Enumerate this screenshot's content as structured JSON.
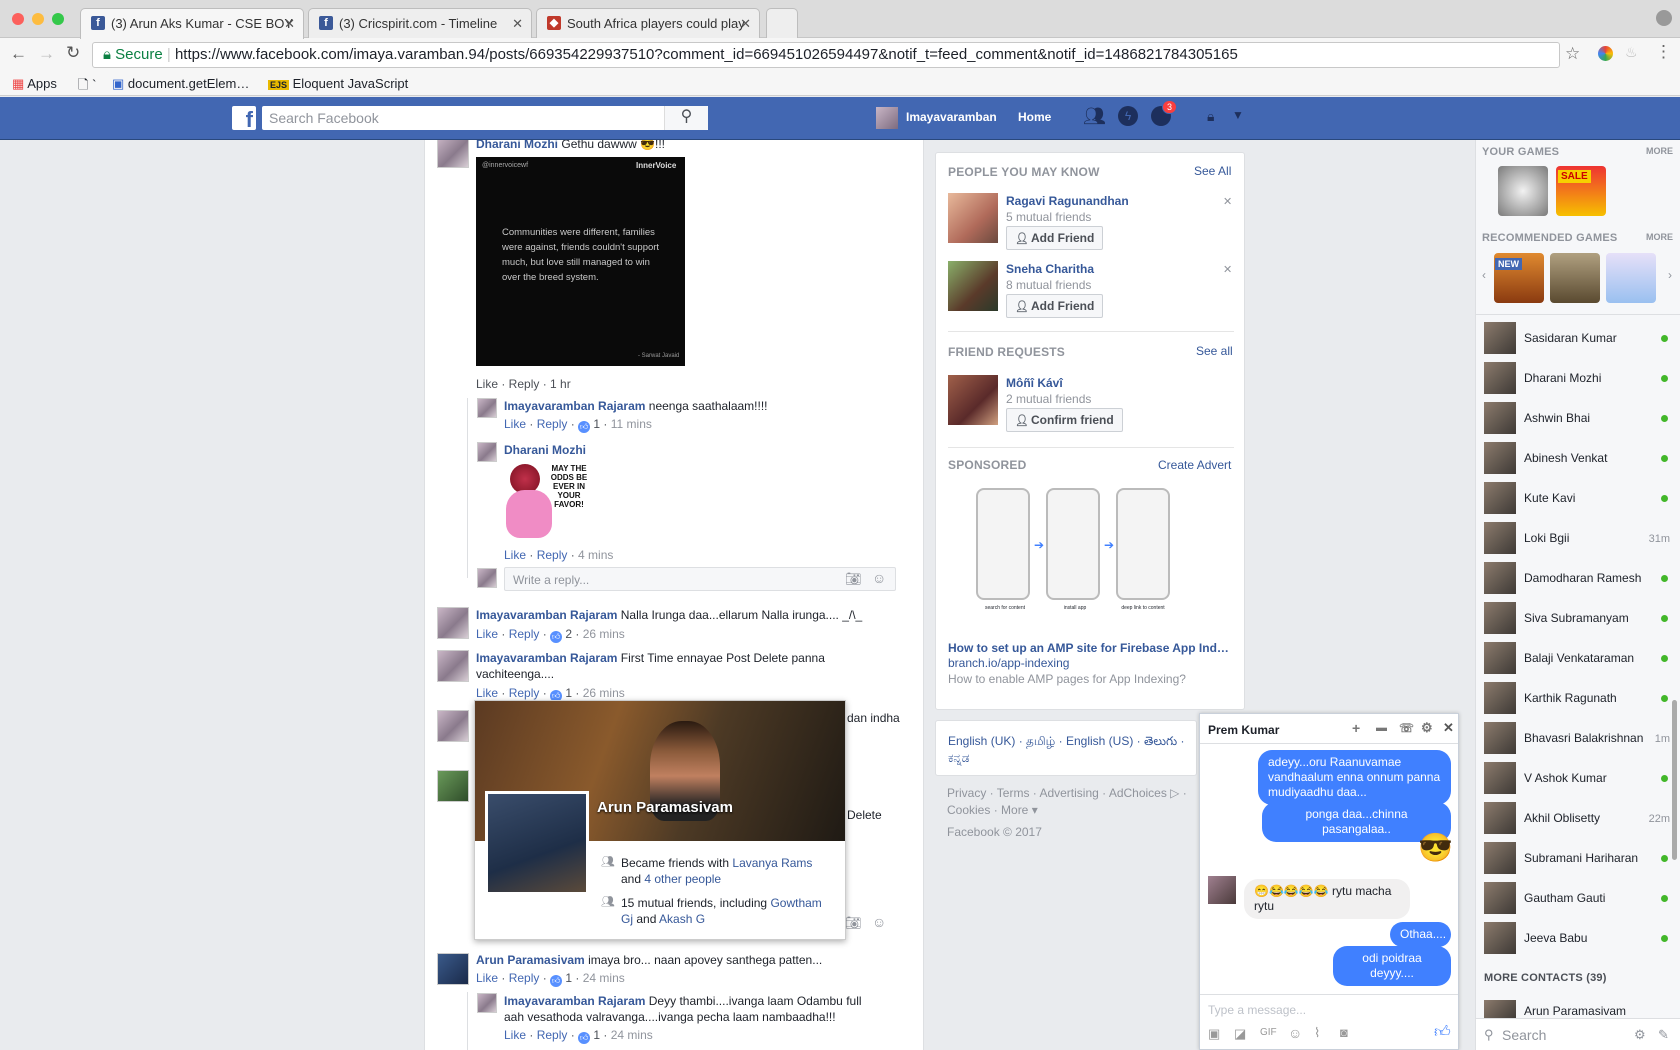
{
  "browser": {
    "tabs": [
      {
        "title": "(3) Arun Aks Kumar - CSE BOY"
      },
      {
        "title": "(3) Cricspirit.com - Timeline"
      },
      {
        "title": "South Africa players could play"
      }
    ],
    "secure_label": "Secure",
    "url": "https://www.facebook.com/imaya.varamban.94/posts/669354229937510?comment_id=669451026594497&notif_t=feed_comment&notif_id=1486821784305165",
    "bookmarks": [
      "Apps",
      "`",
      "document.getElem…",
      "Eloquent JavaScript"
    ]
  },
  "fbheader": {
    "search_placeholder": "Search Facebook",
    "user": "Imayavaramban",
    "home": "Home",
    "notif_count": "3"
  },
  "feed": {
    "c1": {
      "name": "Dharani Mozhi",
      "text": "Gethu dawww 😎!!!",
      "image_quote": "Communities were different, families were against, friends couldn't support much, but love still managed to win over the breed system.",
      "image_brand": "InnerVoice",
      "image_handle": "@innervoicewf",
      "image_author": "- Sarwat Javaid",
      "actions": "Like · Reply · 1 hr"
    },
    "r1": {
      "name": "Imayavaramban Rajaram",
      "text": "neenga saathalaam!!!!",
      "likes": "1",
      "time": "11 mins"
    },
    "r2": {
      "name": "Dharani Mozhi",
      "sticker_text": "MAY THE ODDS BE EVER IN YOUR FAVOR!",
      "time": "4 mins"
    },
    "reply_placeholder": "Write a reply...",
    "c2": {
      "name": "Imayavaramban Rajaram",
      "text": "Nalla Irunga daa...ellarum Nalla irunga.... _/\\_",
      "likes": "2",
      "time": "26 mins"
    },
    "c3": {
      "name": "Imayavaramban Rajaram",
      "text": "First Time ennayae Post Delete panna vachiteenga....",
      "likes": "1",
      "time": "26 mins"
    },
    "c4_fragment": "dan indha",
    "c5_fragment": "Delete",
    "c6": {
      "name": "Arun Paramasivam",
      "text": "imaya bro... naan apovey santhega patten...",
      "likes": "1",
      "time": "24 mins"
    },
    "r3": {
      "name": "Imayavaramban Rajaram",
      "text": "Deyy thambi....ivanga laam Odambu full aah vesathoda valravanga....ivanga pecha laam nambaadha!!!",
      "likes": "1",
      "time": "24 mins"
    },
    "like": "Like",
    "reply": "Reply"
  },
  "hovercard": {
    "name": "Arun Paramasivam",
    "line1_prefix": "Became friends with",
    "line1_link": "Lavanya Rams",
    "line1_mid": "and",
    "line1_link2": "4 other people",
    "line2_prefix": "15 mutual friends, including",
    "line2_link": "Gowtham Gj",
    "line2_mid": "and",
    "line2_link2": "Akash G"
  },
  "pymk": {
    "title": "PEOPLE YOU MAY KNOW",
    "see_all": "See All",
    "people": [
      {
        "name": "Ragavi Ragunandhan",
        "mutual": "5 mutual friends",
        "button": "Add Friend"
      },
      {
        "name": "Sneha Charitha",
        "mutual": "8 mutual friends",
        "button": "Add Friend"
      }
    ]
  },
  "friend_requests": {
    "title": "FRIEND REQUESTS",
    "see_all": "See all",
    "name": "Môñî Kávî",
    "mutual": "2 mutual friends",
    "button": "Confirm friend"
  },
  "sponsored": {
    "title": "SPONSORED",
    "create": "Create Advert",
    "captions": [
      "search for content",
      "install app",
      "deep link to content"
    ],
    "headline": "How to set up an AMP site for Firebase App Ind…",
    "domain": "branch.io/app-indexing",
    "desc": "How to enable AMP pages for App Indexing?"
  },
  "footer": {
    "langs": "English (UK) · தமிழ் · English (US) · తెలుగు · ಕನ್ನಡ",
    "links": "Privacy · Terms · Advertising · AdChoices ▷ · Cookies · More ▾",
    "copyright": "Facebook © 2017"
  },
  "sidebar": {
    "your_games": "YOUR GAMES",
    "more": "MORE",
    "recommended_games": "RECOMMENDED GAMES",
    "sale": "SALE",
    "new": "NEW",
    "contacts": [
      {
        "name": "Sasidaran Kumar",
        "status": ""
      },
      {
        "name": "Dharani Mozhi",
        "status": ""
      },
      {
        "name": "Ashwin Bhai",
        "status": ""
      },
      {
        "name": "Abinesh Venkat",
        "status": ""
      },
      {
        "name": "Kute Kavi",
        "status": ""
      },
      {
        "name": "Loki Bgii",
        "status": "31m"
      },
      {
        "name": "Damodharan Ramesh",
        "status": ""
      },
      {
        "name": "Siva Subramanyam",
        "status": ""
      },
      {
        "name": "Balaji Venkataraman",
        "status": ""
      },
      {
        "name": "Karthik Ragunath",
        "status": ""
      },
      {
        "name": "Bhavasri Balakrishnan",
        "status": "1m"
      },
      {
        "name": "V Ashok Kumar",
        "status": ""
      },
      {
        "name": "Akhil Oblisetty",
        "status": "22m"
      },
      {
        "name": "Subramani Hariharan",
        "status": ""
      },
      {
        "name": "Gautham Gauti",
        "status": ""
      },
      {
        "name": "Jeeva Babu",
        "status": ""
      }
    ],
    "more_contacts": "MORE CONTACTS (39)",
    "more_contact_name": "Arun Paramasivam",
    "search_placeholder": "Search"
  },
  "chat": {
    "title": "Prem Kumar",
    "messages": [
      {
        "text": "adeyy...oru Raanuvamae vandhaalum enna onnum panna mudiyaadhu daa...",
        "dir": "out"
      },
      {
        "text": "ponga daa...chinna pasangalaa..",
        "dir": "out"
      },
      {
        "text": "😎",
        "dir": "out"
      },
      {
        "text": "😁😂😂😂😂 rytu macha rytu",
        "dir": "in"
      },
      {
        "text": "Othaa....",
        "dir": "out"
      },
      {
        "text": "odi poidraa deyyy....",
        "dir": "out"
      }
    ],
    "placeholder": "Type a message..."
  },
  "colors": {
    "fb_blue": "#4267b2",
    "link": "#365899",
    "messenger": "#4080ff",
    "online": "#42b72a"
  }
}
